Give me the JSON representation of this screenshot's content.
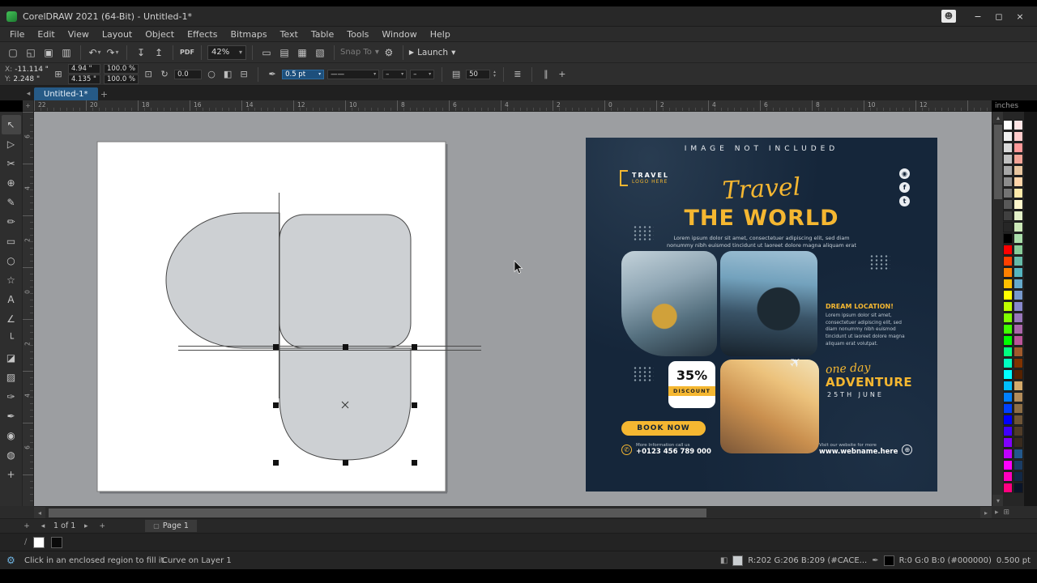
{
  "window": {
    "title": "CorelDRAW 2021 (64-Bit) - Untitled-1*"
  },
  "menubar": {
    "items": [
      "File",
      "Edit",
      "View",
      "Layout",
      "Object",
      "Effects",
      "Bitmaps",
      "Text",
      "Table",
      "Tools",
      "Window",
      "Help"
    ]
  },
  "toolbar_std": {
    "zoom_value": "42%",
    "pdf_label": "PDF",
    "snap_label": "Snap To",
    "launch_label": "Launch"
  },
  "propbar": {
    "x_label": "X:",
    "x_value": "-11.114 \"",
    "y_label": "Y:",
    "y_value": "2.248 \"",
    "width_value": "4.94 \"",
    "height_value": "4.135 \"",
    "scale_x": "100.0",
    "scale_y": "100.0",
    "percent": "%",
    "angle_value": "0.0",
    "outline_width": "0.5 pt",
    "line_style": "——",
    "arrow_start": "–",
    "arrow_end": "–",
    "corner_value": "50"
  },
  "tabbar": {
    "active_tab": "Untitled-1*"
  },
  "rulers": {
    "unit": "inches",
    "h_labels": [
      "22",
      "20",
      "18",
      "16",
      "14",
      "12",
      "10",
      "8",
      "6",
      "4",
      "2",
      "0",
      "2",
      "4",
      "6",
      "8",
      "10",
      "12"
    ],
    "v_labels": [
      "6",
      "4",
      "2",
      "0",
      "2",
      "4",
      "6"
    ]
  },
  "toolbox": {
    "active": "pick-tool",
    "tools": [
      {
        "name": "pick-tool",
        "icon": "pick"
      },
      {
        "name": "shape-tool",
        "icon": "shape"
      },
      {
        "name": "crop-tool",
        "icon": "crop"
      },
      {
        "name": "zoom-tool",
        "icon": "zoom"
      },
      {
        "name": "freehand-tool",
        "icon": "freehand"
      },
      {
        "name": "artistic-media-tool",
        "icon": "brush"
      },
      {
        "name": "rectangle-tool",
        "icon": "rectangle"
      },
      {
        "name": "ellipse-tool",
        "icon": "ellipse"
      },
      {
        "name": "polygon-tool",
        "icon": "polygon"
      },
      {
        "name": "text-tool",
        "icon": "text"
      },
      {
        "name": "parallel-dimension-tool",
        "icon": "dimension"
      },
      {
        "name": "connector-tool",
        "icon": "connector"
      },
      {
        "name": "drop-shadow-tool",
        "icon": "shadow"
      },
      {
        "name": "transparency-tool",
        "icon": "transparency"
      },
      {
        "name": "color-eyedropper-tool",
        "icon": "dropper"
      },
      {
        "name": "outline-pen-tool",
        "icon": "pen"
      },
      {
        "name": "fill-tool",
        "icon": "fill"
      },
      {
        "name": "interactive-fill-tool",
        "icon": "ifill"
      },
      {
        "name": "add-tools-button",
        "icon": "plus"
      }
    ]
  },
  "poster": {
    "banner": "IMAGE NOT INCLUDED",
    "logo_top": "TRAVEL",
    "logo_bottom": "LOGO HERE",
    "script_title": "Travel",
    "main_title": "THE WORLD",
    "body_text": "Lorem ipsum dolor sit amet, consectetuer adipiscing elit, sed diam nonummy nibh euismod tincidunt ut laoreet dolore magna aliquam erat volutpat.",
    "dream_title": "DREAM LOCATION!",
    "dream_body": "Lorem ipsum dolor sit amet, consectetuer adipiscing elit, sed diam nonummy nibh euismod tincidunt ut laoreet dolore magna aliquam erat volutpat.",
    "discount_value": "35%",
    "discount_label": "DISCOUNT",
    "adv_script": "one day",
    "adv_title": "ADVENTURE",
    "adv_date": "25TH JUNE",
    "cta": "BOOK NOW",
    "phone_label": "More Information call us",
    "phone_number": "+0123 456 789 000",
    "web_label": "Visit our website for more",
    "web_url": "www.webname.here"
  },
  "pagebar": {
    "page_info": "1 of 1",
    "page_tab": "Page 1"
  },
  "statusbar": {
    "hint": "Click in an enclosed region to fill it.",
    "object_info": "Curve on Layer 1",
    "fill_label": "R:202 G:206 B:209 (#CACE...",
    "outline_label": "R:0 G:0 B:0 (#000000)",
    "outline_width": "0.500 pt",
    "fill_color": "#CACED1",
    "outline_color": "#000000"
  },
  "colors": {
    "accent": "#f5b731",
    "canvas_bg": "#9c9ea1",
    "ui_bg": "#2e2e2e",
    "poster_bg": "#15263a",
    "shape_fill": "#cdd0d3"
  },
  "palette": {
    "columns": [
      [
        "#FFFFFF",
        "#F0F0F0",
        "#D9D9D9",
        "#C0C0C0",
        "#A6A6A6",
        "#8C8C8C",
        "#737373",
        "#595959",
        "#404040",
        "#262626",
        "#000000",
        "#FF0000",
        "#FF4000",
        "#FF8000",
        "#FFBF00",
        "#FFFF00",
        "#BFFF00",
        "#80FF00",
        "#40FF00",
        "#00FF00",
        "#00FF80",
        "#00FFBF",
        "#00FFFF",
        "#00BFFF",
        "#0080FF",
        "#0040FF",
        "#0000FF",
        "#4000FF",
        "#8000FF",
        "#BF00FF",
        "#FF00FF",
        "#FF00BF",
        "#FF0080"
      ],
      [
        "#FFE5E5",
        "#FFCCCC",
        "#FF9999",
        "#F2A497",
        "#E8C6A0",
        "#FFD5AA",
        "#FFEAAA",
        "#FFF7CC",
        "#E3F0C8",
        "#CCE8B8",
        "#AADDAA",
        "#88CC99",
        "#66BBA8",
        "#55B5C0",
        "#66AACC",
        "#7799CC",
        "#8888CC",
        "#9977BB",
        "#AA66AA",
        "#BB5599",
        "#A05A2C",
        "#803300",
        "#552200",
        "#D4AA6A",
        "#B38C5A",
        "#8C6E46",
        "#6E5537",
        "#503C28",
        "#392B1E",
        "#23588C",
        "#1A3C64",
        "#122846",
        "#0A1428"
      ]
    ]
  },
  "icons": {
    "new-document": "▢",
    "open": "◱",
    "save": "▣",
    "print": "▥",
    "undo": "↶",
    "redo": "↷",
    "dropdown": "▾",
    "import": "↧",
    "export": "↥",
    "fullscreen": "▭",
    "rulers": "▤",
    "grid": "▦",
    "guidelines": "▧",
    "gear": "⚙",
    "launch": "▶",
    "avatar": "☻",
    "minimize": "−",
    "maximize": "◻",
    "close": "×",
    "size": "⊞",
    "lock": "⊡",
    "rotate": "↻",
    "circle": "○",
    "mirror-h": "◧",
    "mirror-v": "⊟",
    "pen": "✒",
    "spin-up": "▴",
    "spin-down": "▾",
    "left": "◂",
    "right": "▸",
    "up": "▴",
    "down": "▾",
    "plus": "+",
    "pan": "⊞",
    "props": "≣",
    "columns": "∥",
    "fill-ind": "◧",
    "phone": "✆",
    "globe": "⊕",
    "plane": "✈",
    "instagram": "◉",
    "facebook": "f",
    "twitter": "t",
    "origin": "+",
    "wrap": "▤",
    "slash": "∕",
    "pick": "↖",
    "shape": "▷",
    "crop": "✂",
    "zoom": "⊕",
    "freehand": "✎",
    "brush": "✏",
    "rectangle": "▭",
    "ellipse": "○",
    "polygon": "☆",
    "text": "A",
    "dimension": "∠",
    "connector": "└",
    "shadow": "◪",
    "transparency": "▨",
    "dropper": "✑",
    "fill": "◉",
    "ifill": "◍"
  }
}
